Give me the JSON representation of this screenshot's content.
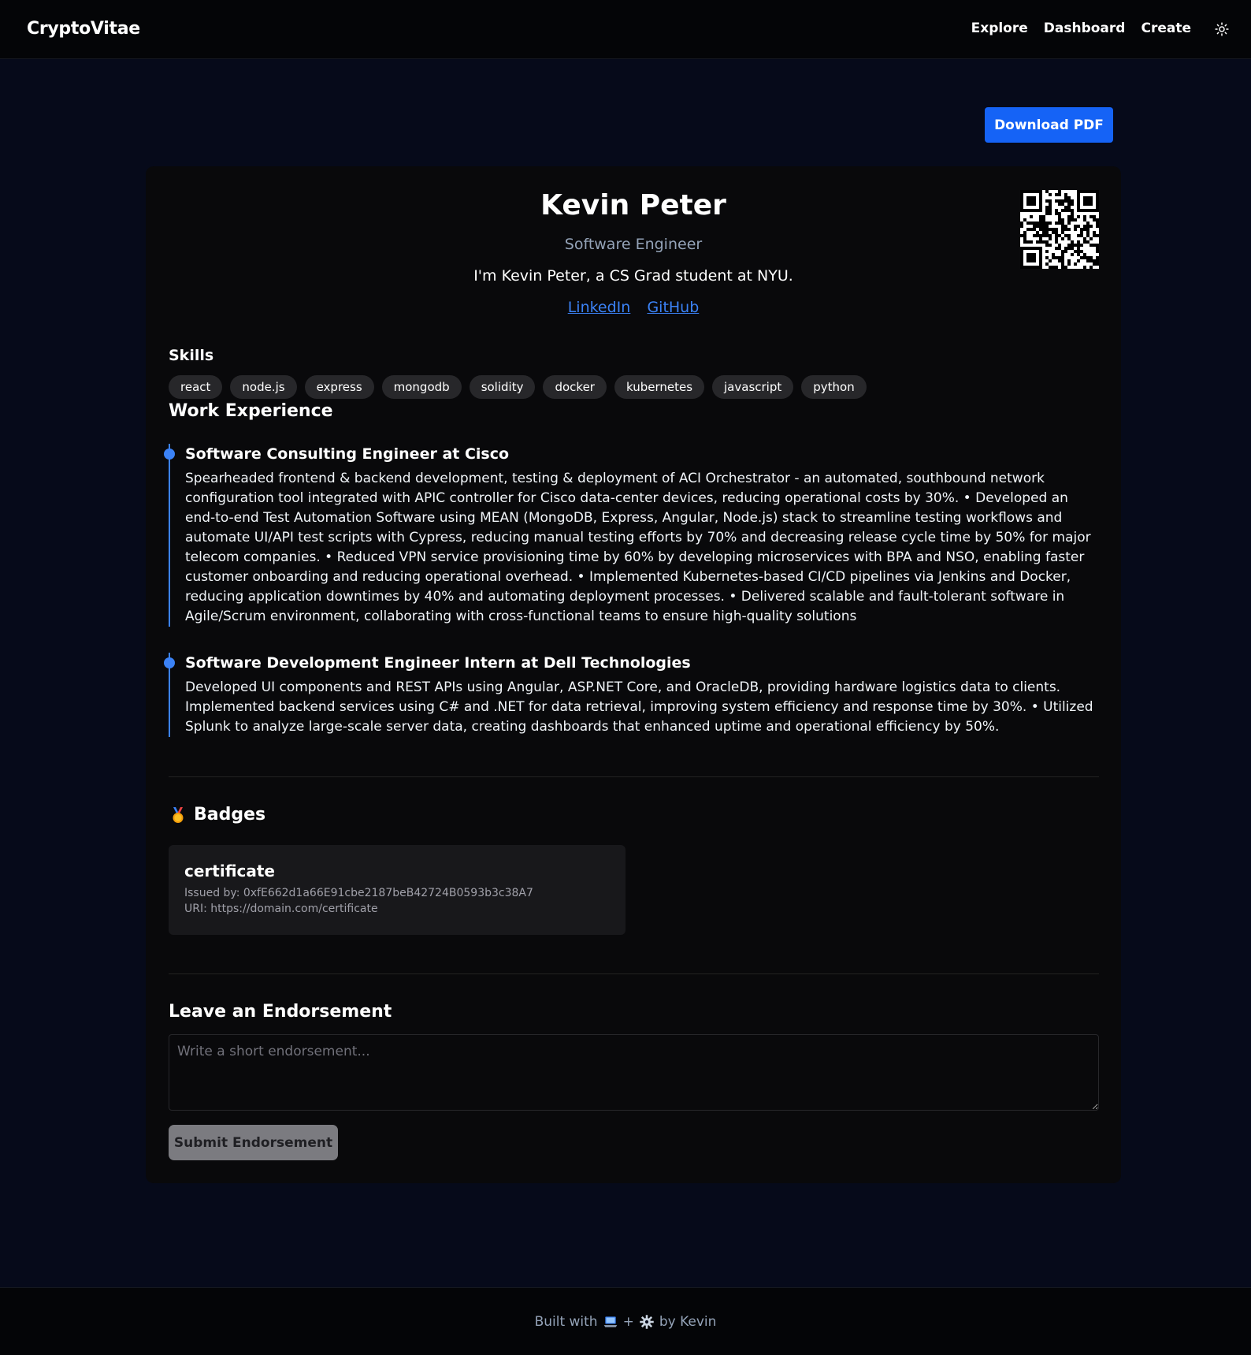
{
  "nav": {
    "brand": "CryptoVitae",
    "links": [
      "Explore",
      "Dashboard",
      "Create"
    ],
    "theme_icon": "sun-icon"
  },
  "actions": {
    "download_pdf": "Download PDF"
  },
  "profile": {
    "name": "Kevin Peter",
    "title": "Software Engineer",
    "bio": "I'm Kevin Peter, a CS Grad student at NYU.",
    "links": [
      "LinkedIn",
      "GitHub"
    ]
  },
  "skills": {
    "heading": "Skills",
    "items": [
      "react",
      "node.js",
      "express",
      "mongodb",
      "solidity",
      "docker",
      "kubernetes",
      "javascript",
      "python"
    ]
  },
  "work": {
    "heading": "Work Experience",
    "jobs": [
      {
        "title": "Software Consulting Engineer at Cisco",
        "description": "Spearheaded frontend & backend development, testing & deployment of ACI Orchestrator - an automated, southbound network configuration tool integrated with APIC controller for Cisco data-center devices, reducing operational costs by 30%. • Developed an end-to-end Test Automation Software using MEAN (MongoDB, Express, Angular, Node.js) stack to streamline testing workflows and automate UI/API test scripts with Cypress, reducing manual testing efforts by 70% and decreasing release cycle time by 50% for major telecom companies. • Reduced VPN service provisioning time by 60% by developing microservices with BPA and NSO, enabling faster customer onboarding and reducing operational overhead. • Implemented Kubernetes-based CI/CD pipelines via Jenkins and Docker, reducing application downtimes by 40% and automating deployment processes. • Delivered scalable and fault-tolerant software in Agile/Scrum environment, collaborating with cross-functional teams to ensure high-quality solutions"
      },
      {
        "title": "Software Development Engineer Intern at Dell Technologies",
        "description": "Developed UI components and REST APIs using Angular, ASP.NET Core, and OracleDB, providing hardware logistics data to clients. Implemented backend services using C# and .NET for data retrieval, improving system efficiency and response time by 30%. • Utilized Splunk to analyze large-scale server data, creating dashboards that enhanced uptime and operational efficiency by 50%."
      }
    ]
  },
  "badges": {
    "heading": "Badges",
    "icon": "medal-icon",
    "items": [
      {
        "name": "certificate",
        "issuer": "Issued by: 0xfE662d1a66E91cbe2187beB42724B0593b3c38A7",
        "uri": "URI: https://domain.com/certificate"
      }
    ]
  },
  "endorsement": {
    "heading": "Leave an Endorsement",
    "placeholder": "Write a short endorsement...",
    "value": "",
    "submit": "Submit Endorsement"
  },
  "footer": {
    "prefix": "Built with",
    "plus": "+",
    "suffix": "by Kevin",
    "icons": [
      "laptop-icon",
      "gear-icon"
    ]
  }
}
